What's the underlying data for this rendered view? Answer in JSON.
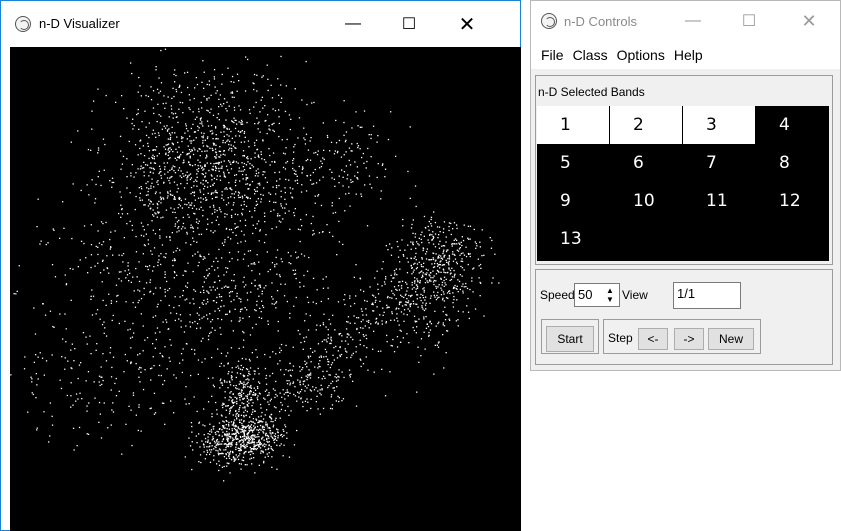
{
  "visualizer": {
    "title": "n-D Visualizer",
    "point_color": "#ffffff",
    "background_color": "#000000",
    "window_border_color": "#1883d7"
  },
  "controls": {
    "title": "n-D Controls",
    "menu": [
      "File",
      "Class",
      "Options",
      "Help"
    ],
    "bands_label": "n-D Selected Bands",
    "bands": [
      {
        "label": "1",
        "selected": true
      },
      {
        "label": "2",
        "selected": true
      },
      {
        "label": "3",
        "selected": true
      },
      {
        "label": "4",
        "selected": false
      },
      {
        "label": "5",
        "selected": false
      },
      {
        "label": "6",
        "selected": false
      },
      {
        "label": "7",
        "selected": false
      },
      {
        "label": "8",
        "selected": false
      },
      {
        "label": "9",
        "selected": false
      },
      {
        "label": "10",
        "selected": false
      },
      {
        "label": "11",
        "selected": false
      },
      {
        "label": "12",
        "selected": false
      },
      {
        "label": "13",
        "selected": false
      }
    ],
    "speed_label": "Speed",
    "speed_value": "50",
    "view_label": "View",
    "view_value": "1/1",
    "start_label": "Start",
    "step_label": "Step",
    "back_label": "<-",
    "forward_label": "->",
    "new_label": "New"
  },
  "icons": [
    "app-icon",
    "minimize-icon",
    "maximize-icon",
    "close-icon",
    "spin-up-icon",
    "spin-down-icon"
  ]
}
